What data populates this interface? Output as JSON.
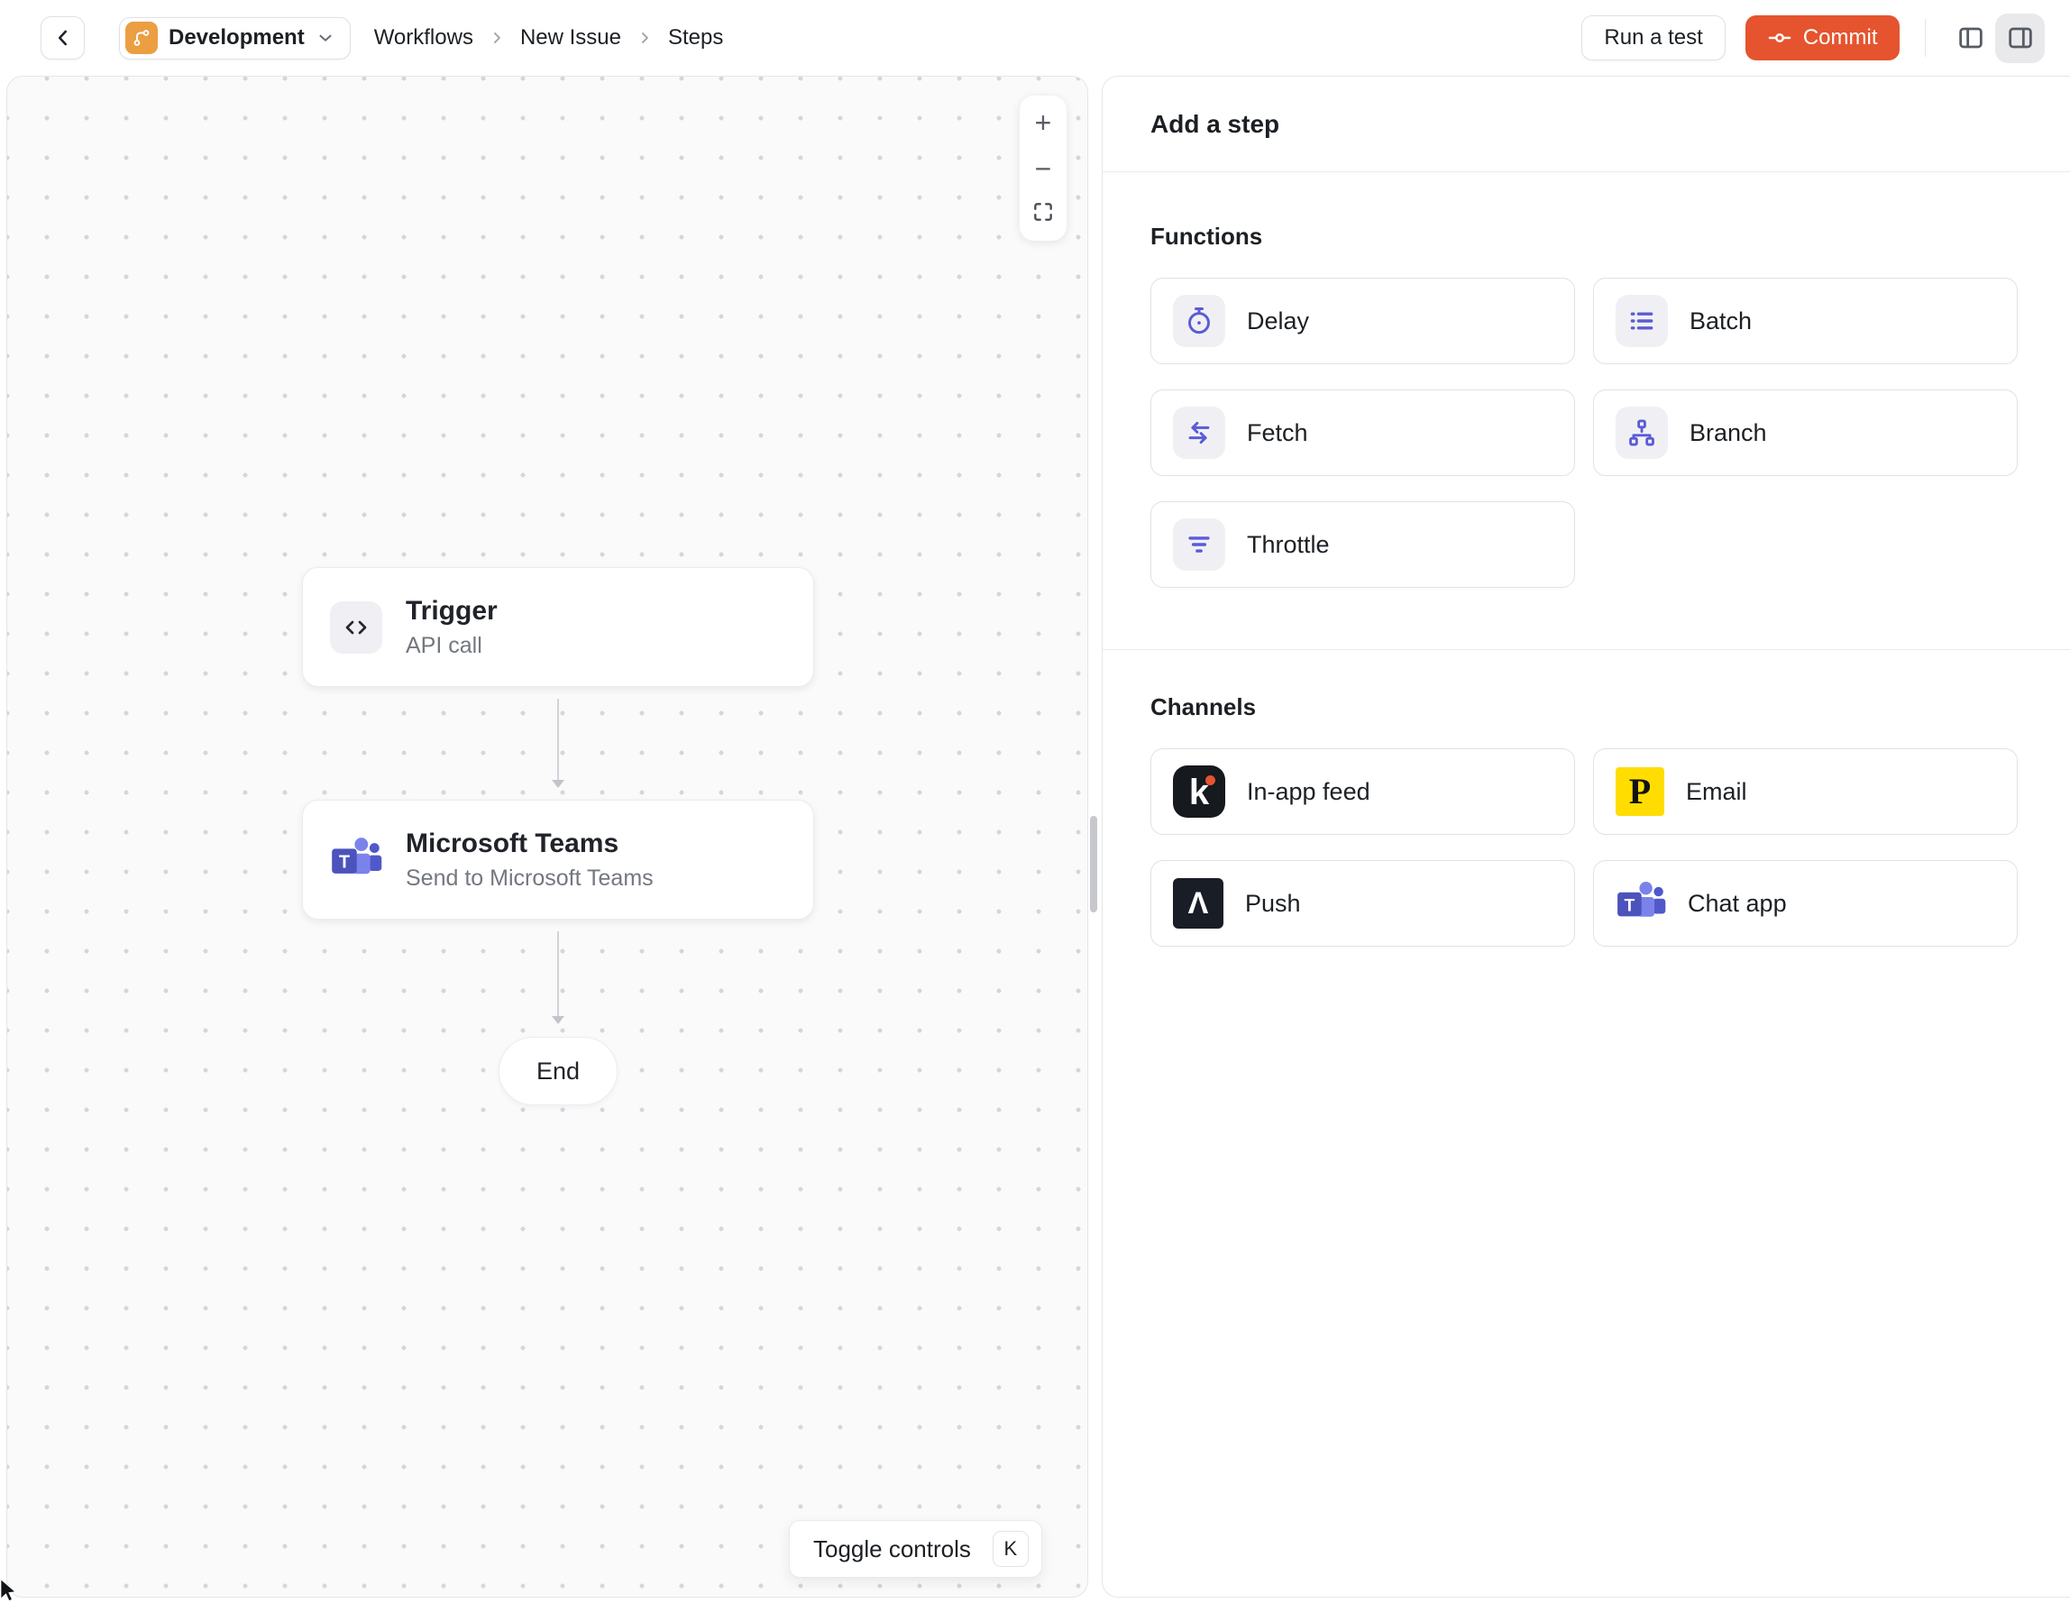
{
  "header": {
    "environment": "Development",
    "breadcrumb": [
      "Workflows",
      "New Issue",
      "Steps"
    ],
    "run_test_label": "Run a test",
    "commit_label": "Commit"
  },
  "canvas": {
    "zoom_controls": {
      "zoom_in": "+",
      "zoom_out": "−"
    },
    "nodes": {
      "trigger": {
        "title": "Trigger",
        "subtitle": "API call"
      },
      "teams": {
        "title": "Microsoft Teams",
        "subtitle": "Send to Microsoft Teams"
      },
      "end": {
        "label": "End"
      }
    },
    "toggle_controls": {
      "label": "Toggle controls",
      "shortcut": "K"
    }
  },
  "panel": {
    "title": "Add a step",
    "functions": {
      "label": "Functions",
      "items": [
        {
          "label": "Delay",
          "icon": "stopwatch-icon"
        },
        {
          "label": "Batch",
          "icon": "list-icon"
        },
        {
          "label": "Fetch",
          "icon": "swap-arrows-icon"
        },
        {
          "label": "Branch",
          "icon": "tree-icon"
        },
        {
          "label": "Throttle",
          "icon": "funnel-lines-icon"
        }
      ]
    },
    "channels": {
      "label": "Channels",
      "items": [
        {
          "label": "In-app feed",
          "icon": "knock-logo"
        },
        {
          "label": "Email",
          "icon": "postmark-logo"
        },
        {
          "label": "Push",
          "icon": "expo-logo"
        },
        {
          "label": "Chat app",
          "icon": "ms-teams-logo"
        }
      ]
    }
  },
  "logos": {
    "knock_letter": "k",
    "postmark_letter": "P",
    "expo_caret": "Λ",
    "teams_letter": "T"
  },
  "colors": {
    "accent_indigo": "#5B5BD6",
    "commit_button": "#E5542E",
    "environment_icon": "#EC9E42",
    "knock_bg": "#16191D",
    "postmark_bg": "#FFDD00",
    "expo_bg": "#191D26",
    "teams_purple": "#4B53BC",
    "canvas_bg": "#FAFAFB",
    "canvas_dot": "#D5D5DD"
  }
}
